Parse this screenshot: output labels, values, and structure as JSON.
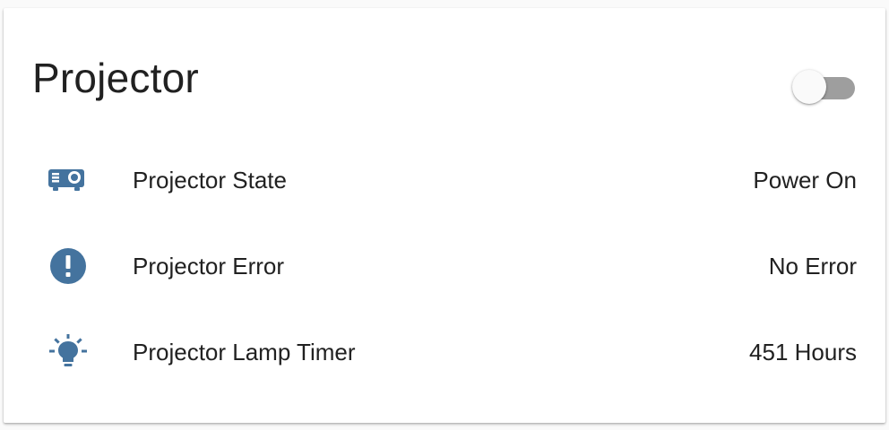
{
  "card": {
    "title": "Projector",
    "toggle": {
      "state": "off"
    }
  },
  "entities": [
    {
      "icon": "projector-icon",
      "label": "Projector State",
      "value": "Power On"
    },
    {
      "icon": "alert-circle-icon",
      "label": "Projector Error",
      "value": "No Error"
    },
    {
      "icon": "lightbulb-icon",
      "label": "Projector Lamp Timer",
      "value": "451 Hours"
    }
  ],
  "colors": {
    "icon": "#44739e",
    "text": "#212121",
    "toggle_track_off": "#9e9e9e",
    "toggle_knob_off": "#fafafa"
  }
}
